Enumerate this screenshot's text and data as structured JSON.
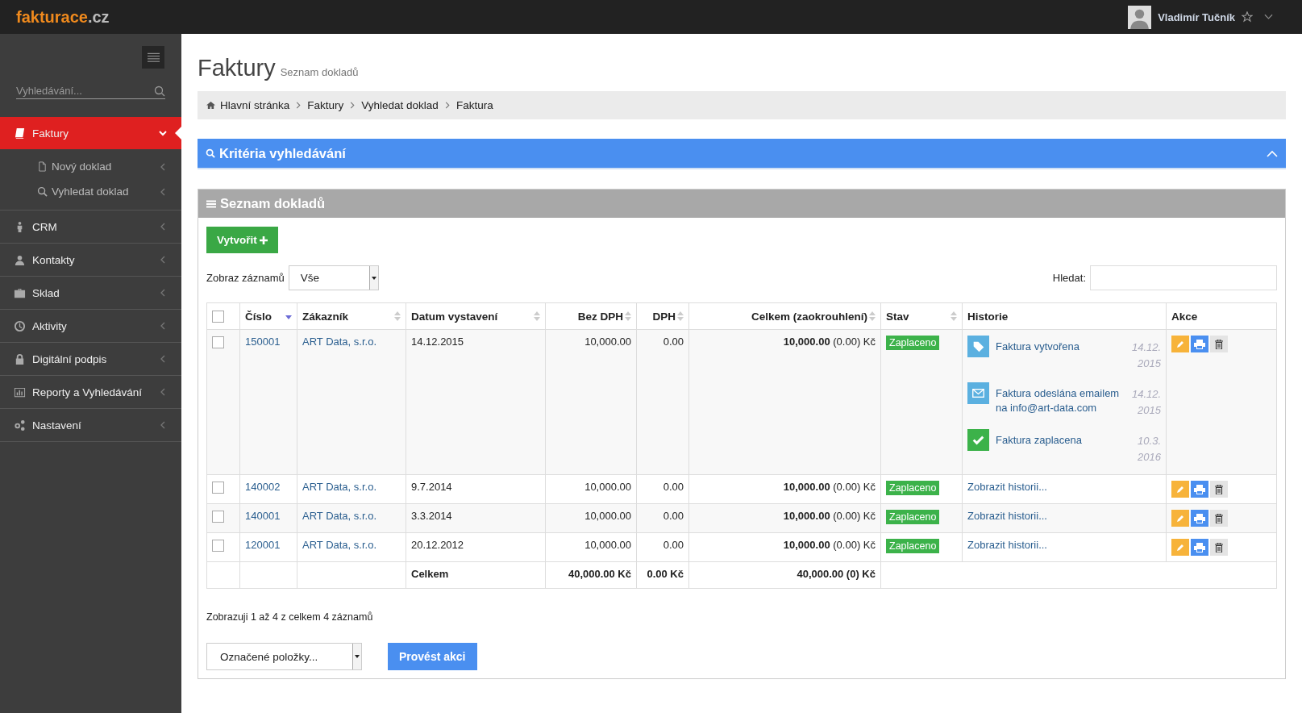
{
  "brand": {
    "name": "fakturace",
    "tld": ".cz"
  },
  "user": {
    "name": "Vladimír Tučník"
  },
  "sidebar": {
    "search_placeholder": "Vyhledávání...",
    "items": [
      {
        "label": "Faktury",
        "kind": "book",
        "selected": true,
        "expanded": true,
        "children": [
          {
            "label": "Nový doklad",
            "kind": "file"
          },
          {
            "label": "Vyhledat doklad",
            "kind": "search"
          }
        ]
      },
      {
        "label": "CRM",
        "kind": "person",
        "selected": false,
        "expanded": false
      },
      {
        "label": "Kontakty",
        "kind": "user",
        "selected": false,
        "expanded": false
      },
      {
        "label": "Sklad",
        "kind": "briefcase",
        "selected": false,
        "expanded": false
      },
      {
        "label": "Aktivity",
        "kind": "clock",
        "selected": false,
        "expanded": false
      },
      {
        "label": "Digitální podpis",
        "kind": "lock",
        "selected": false,
        "expanded": false
      },
      {
        "label": "Reporty a Vyhledávání",
        "kind": "chart",
        "selected": false,
        "expanded": false
      },
      {
        "label": "Nastavení",
        "kind": "gears",
        "selected": false,
        "expanded": false
      }
    ]
  },
  "page": {
    "title": "Faktury",
    "subtitle": "Seznam dokladů"
  },
  "breadcrumb": [
    "Hlavní stránka",
    "Faktury",
    "Vyhledat doklad",
    "Faktura"
  ],
  "criteria_panel": {
    "title": "Kritéria vyhledávání"
  },
  "list_panel": {
    "title": "Seznam dokladů",
    "create_button": "Vytvořit",
    "page_size": {
      "label": "Zobraz záznamů",
      "value": "Vše"
    },
    "search_label": "Hledat:",
    "columns": [
      {
        "kind": "checkbox",
        "checked": false
      },
      {
        "kind": "text",
        "label": "Číslo",
        "sortable": true,
        "sorted": true
      },
      {
        "kind": "text",
        "label": "Zákazník",
        "sortable": true,
        "sorted": false
      },
      {
        "kind": "text",
        "label": "Datum vystavení",
        "sortable": true,
        "sorted": false
      },
      {
        "kind": "number",
        "label": "Bez DPH",
        "sortable": true,
        "sorted": false
      },
      {
        "kind": "number",
        "label": "DPH",
        "sortable": true,
        "sorted": false
      },
      {
        "kind": "number",
        "label": "Celkem (zaokrouhlení)",
        "sortable": true,
        "sorted": false
      },
      {
        "kind": "text",
        "label": "Stav",
        "sortable": true,
        "sorted": false
      },
      {
        "kind": "text",
        "label": "Historie",
        "sortable": false
      },
      {
        "kind": "text",
        "label": "Akce",
        "sortable": false
      }
    ],
    "rows": [
      {
        "checked": false,
        "number": "150001",
        "customer": "ART Data, s.r.o.",
        "date": "14.12.2015",
        "net": "10,000.00",
        "vat": "0.00",
        "total": "**10,000.00** (0.00) Kč",
        "status": "Zaplaceno",
        "history": [
          {
            "kind": "tag",
            "text": "Faktura vytvořena",
            "date": "14.12. 2015"
          },
          {
            "kind": "mail",
            "text": "Faktura odeslána emailem na info@art-data.com",
            "date": "14.12. 2015"
          },
          {
            "kind": "check",
            "text": "Faktura zaplacena",
            "date": "10.3. 2016"
          }
        ]
      },
      {
        "checked": false,
        "number": "140002",
        "customer": "ART Data, s.r.o.",
        "date": "9.7.2014",
        "net": "10,000.00",
        "vat": "0.00",
        "total": "**10,000.00** (0.00) Kč",
        "status": "Zaplaceno",
        "history_link": "Zobrazit historii..."
      },
      {
        "checked": false,
        "number": "140001",
        "customer": "ART Data, s.r.o.",
        "date": "3.3.2014",
        "net": "10,000.00",
        "vat": "0.00",
        "total": "**10,000.00** (0.00) Kč",
        "status": "Zaplaceno",
        "history_link": "Zobrazit historii..."
      },
      {
        "checked": false,
        "number": "120001",
        "customer": "ART Data, s.r.o.",
        "date": "20.12.2012",
        "net": "10,000.00",
        "vat": "0.00",
        "total": "**10,000.00** (0.00) Kč",
        "status": "Zaplaceno",
        "history_link": "Zobrazit historii..."
      }
    ],
    "totals": {
      "label": "Celkem",
      "net": "40,000.00 Kč",
      "vat": "0.00 Kč",
      "total": "40,000.00 (0) Kč"
    },
    "info": "Zobrazuji 1 až 4 z celkem 4 záznamů",
    "bulk_select": "Označené položky...",
    "action_button": "Provést akci"
  }
}
